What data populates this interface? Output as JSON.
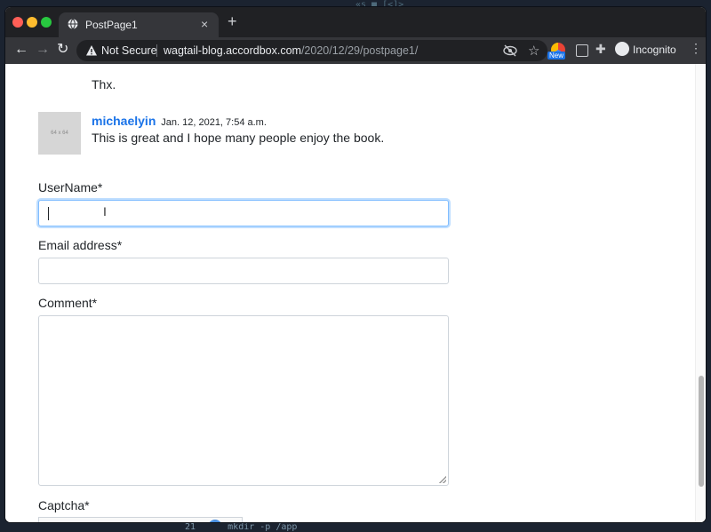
{
  "terminal": {
    "top_text": "«s ■ [<]>",
    "bottom_text": "21      mkdir -p /app"
  },
  "browser": {
    "tab_title": "PostPage1",
    "new_tab_symbol": "+",
    "close_symbol": "×",
    "security_label": "Not Secure",
    "url_host": "wagtail-blog.accordbox.com",
    "url_path": "/2020/12/29/postpage1/",
    "new_badge": "New",
    "profile_label": "Incognito",
    "icons": [
      "back-icon",
      "forward-icon",
      "reload-icon",
      "warning-icon",
      "eye-off-icon",
      "star-icon",
      "extension-icon",
      "puzzle-icon",
      "incognito-icon",
      "menu-icon"
    ]
  },
  "page": {
    "previous_comment": "Thx.",
    "comment": {
      "avatar_text": "64 x 64",
      "author": "michaelyin",
      "date": "Jan. 12, 2021, 7:54 a.m.",
      "body": "This is great and I hope many people enjoy the book."
    },
    "form": {
      "username_label": "UserName*",
      "email_label": "Email address*",
      "comment_label": "Comment*",
      "captcha_label": "Captcha*"
    }
  },
  "colors": {
    "link": "#1a73e8",
    "focus_border": "#80bdff",
    "chrome_dark": "#202124"
  }
}
